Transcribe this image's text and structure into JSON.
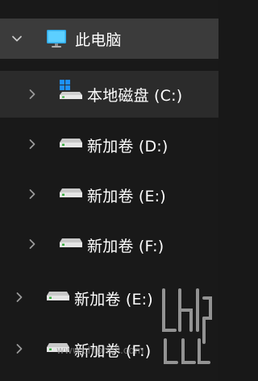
{
  "tree": {
    "root": {
      "label": "此电脑",
      "icon": "monitor-icon",
      "expanded": true
    },
    "items": [
      {
        "label": "本地磁盘 (C:)",
        "icon": "windows-drive-icon"
      },
      {
        "label": "新加卷 (D:)",
        "icon": "drive-icon"
      },
      {
        "label": "新加卷 (E:)",
        "icon": "drive-icon"
      },
      {
        "label": "新加卷 (F:)",
        "icon": "drive-icon"
      },
      {
        "label": "新加卷 (E:)",
        "icon": "drive-icon"
      },
      {
        "label": "新加卷 (F:)",
        "icon": "drive-icon"
      }
    ]
  },
  "watermark": {
    "text": "www.chiphell.com"
  },
  "colors": {
    "background": "#191919",
    "root_row": "#3b3b3b",
    "selected_row": "#2b2b2b",
    "text": "#ffffff",
    "chevron": "#a0a0a0",
    "monitor_accent": "#4cc2ff",
    "windows_blue": "#1e90ff",
    "drive_green": "#3cb043"
  }
}
